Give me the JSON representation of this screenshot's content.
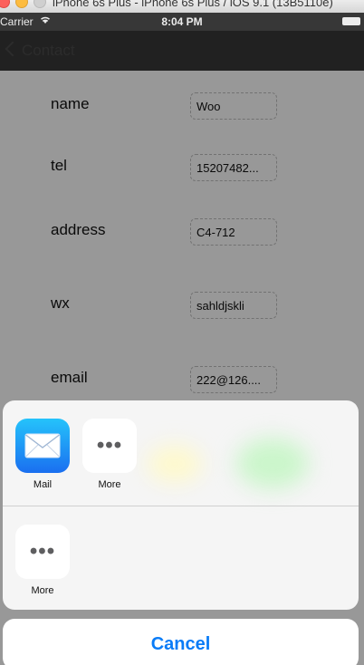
{
  "simulator": {
    "title": "iPhone 6s Plus - iPhone 6s Plus / iOS 9.1 (13B5110e)"
  },
  "status_bar": {
    "carrier": "Carrier",
    "wifi_icon": "wifi-icon",
    "time": "8:04 PM",
    "battery_icon": "battery-icon"
  },
  "nav_bar": {
    "back_label": "Contact",
    "back_icon": "chevron-left-icon"
  },
  "form": {
    "fields": [
      {
        "label": "name",
        "value": "Woo"
      },
      {
        "label": "tel",
        "value": "15207482..."
      },
      {
        "label": "address",
        "value": "C4-712"
      },
      {
        "label": "wx",
        "value": "sahldjskli"
      },
      {
        "label": "email",
        "value": "222@126...."
      }
    ]
  },
  "share_sheet": {
    "row1": [
      {
        "label": "Mail",
        "icon": "mail-envelope-icon"
      },
      {
        "label": "More",
        "icon": "more-dots-icon"
      }
    ],
    "row2": [
      {
        "label": "More",
        "icon": "more-dots-icon"
      }
    ],
    "cancel_label": "Cancel"
  },
  "colors": {
    "accent": "#0a7cf7",
    "nav_background": "#373737",
    "mail_gradient_top": "#25c3fb",
    "mail_gradient_bottom": "#1a6ff0"
  }
}
